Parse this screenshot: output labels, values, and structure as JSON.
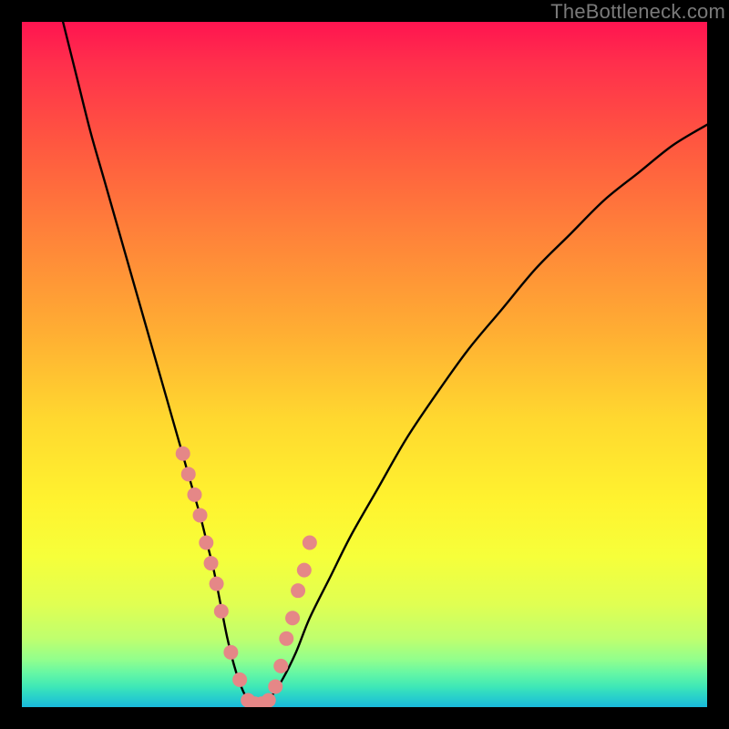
{
  "watermark": "TheBottleneck.com",
  "colors": {
    "curve": "#000000",
    "points": "#e58787",
    "frame": "#000000"
  },
  "chart_data": {
    "type": "line",
    "title": "",
    "xlabel": "",
    "ylabel": "",
    "xlim": [
      0,
      100
    ],
    "ylim": [
      0,
      100
    ],
    "grid": false,
    "legend": false,
    "series": [
      {
        "name": "bottleneck-curve",
        "x": [
          6,
          8,
          10,
          12,
          14,
          16,
          18,
          20,
          22,
          24,
          26,
          27,
          28,
          29,
          30,
          31,
          32,
          33,
          34,
          35,
          36,
          38,
          40,
          42,
          45,
          48,
          52,
          56,
          60,
          65,
          70,
          75,
          80,
          85,
          90,
          95,
          100
        ],
        "y": [
          100,
          92,
          84,
          77,
          70,
          63,
          56,
          49,
          42,
          35,
          28,
          24,
          20,
          15,
          10,
          6,
          3,
          1,
          0,
          0,
          1,
          4,
          8,
          13,
          19,
          25,
          32,
          39,
          45,
          52,
          58,
          64,
          69,
          74,
          78,
          82,
          85
        ]
      }
    ],
    "points": {
      "name": "highlighted-points",
      "x": [
        23.5,
        24.3,
        25.2,
        26.0,
        26.9,
        27.6,
        28.4,
        29.1,
        30.5,
        31.8,
        33.0,
        34.0,
        35.0,
        36.0,
        37.0,
        37.8,
        38.6,
        39.5,
        40.3,
        41.2,
        42.0
      ],
      "y": [
        37,
        34,
        31,
        28,
        24,
        21,
        18,
        14,
        8,
        4,
        1,
        0.5,
        0.5,
        1,
        3,
        6,
        10,
        13,
        17,
        20,
        24
      ]
    }
  }
}
